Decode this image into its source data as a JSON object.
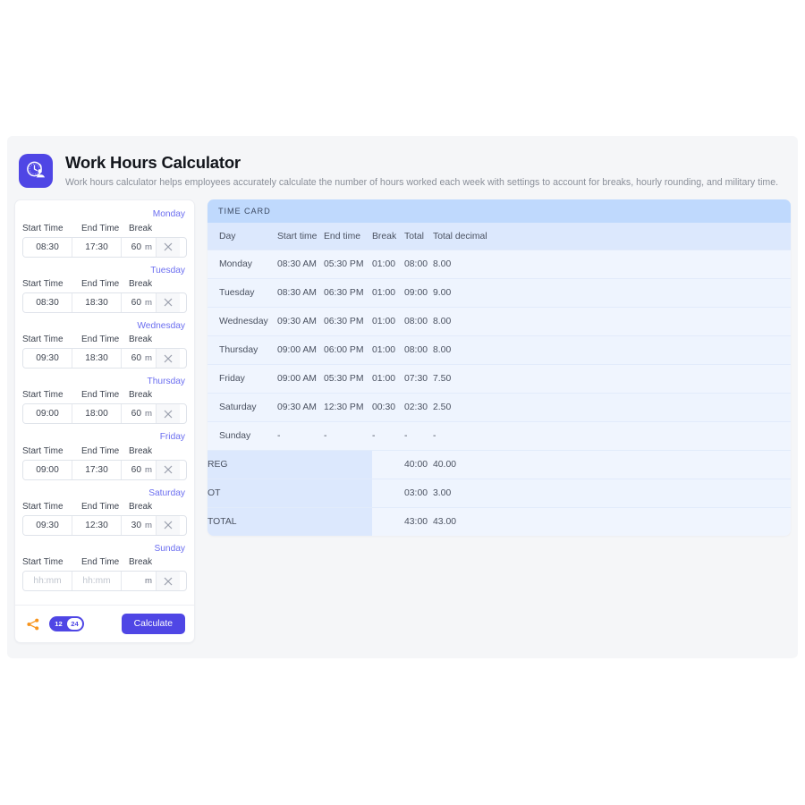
{
  "header": {
    "icon": "clock-hand-icon",
    "title": "Work Hours Calculator",
    "subtitle": "Work hours calculator helps employees accurately calculate the number of hours worked each week with settings to account for breaks, hourly rounding, and military time."
  },
  "form": {
    "column_headers": {
      "start": "Start Time",
      "end": "End Time",
      "break": "Break"
    },
    "break_unit": "m",
    "time_placeholder": "hh:mm",
    "break_placeholder": "",
    "clear_icon": "close-x-icon",
    "rows": [
      {
        "day": "Monday",
        "start": "08:30",
        "end": "17:30",
        "break": "60"
      },
      {
        "day": "Tuesday",
        "start": "08:30",
        "end": "18:30",
        "break": "60"
      },
      {
        "day": "Wednesday",
        "start": "09:30",
        "end": "18:30",
        "break": "60"
      },
      {
        "day": "Thursday",
        "start": "09:00",
        "end": "18:00",
        "break": "60"
      },
      {
        "day": "Friday",
        "start": "09:00",
        "end": "17:30",
        "break": "60"
      },
      {
        "day": "Saturday",
        "start": "09:30",
        "end": "12:30",
        "break": "30"
      },
      {
        "day": "Sunday",
        "start": "",
        "end": "",
        "break": ""
      }
    ],
    "footer": {
      "share_icon": "share-nodes-icon",
      "hour_format_12": "12",
      "hour_format_24": "24",
      "hour_format_selected": "24",
      "calculate_label": "Calculate"
    }
  },
  "time_card": {
    "title": "TIME CARD",
    "headers": [
      "Day",
      "Start time",
      "End time",
      "Break",
      "Total",
      "Total decimal"
    ],
    "rows": [
      {
        "day": "Monday",
        "start": "08:30 AM",
        "end": "05:30 PM",
        "break": "01:00",
        "total": "08:00",
        "decimal": "8.00"
      },
      {
        "day": "Tuesday",
        "start": "08:30 AM",
        "end": "06:30 PM",
        "break": "01:00",
        "total": "09:00",
        "decimal": "9.00"
      },
      {
        "day": "Wednesday",
        "start": "09:30 AM",
        "end": "06:30 PM",
        "break": "01:00",
        "total": "08:00",
        "decimal": "8.00"
      },
      {
        "day": "Thursday",
        "start": "09:00 AM",
        "end": "06:00 PM",
        "break": "01:00",
        "total": "08:00",
        "decimal": "8.00"
      },
      {
        "day": "Friday",
        "start": "09:00 AM",
        "end": "05:30 PM",
        "break": "01:00",
        "total": "07:30",
        "decimal": "7.50"
      },
      {
        "day": "Saturday",
        "start": "09:30 AM",
        "end": "12:30 PM",
        "break": "00:30",
        "total": "02:30",
        "decimal": "2.50"
      },
      {
        "day": "Sunday",
        "start": "-",
        "end": "-",
        "break": "-",
        "total": "-",
        "decimal": "-"
      }
    ],
    "summary": [
      {
        "label": "REG",
        "total": "40:00",
        "decimal": "40.00"
      },
      {
        "label": "OT",
        "total": "03:00",
        "decimal": "3.00"
      },
      {
        "label": "TOTAL",
        "total": "43:00",
        "decimal": "43.00"
      }
    ]
  },
  "colors": {
    "accent": "#4f46e5",
    "day_label": "#6b6ef0",
    "card_header": "#bfd9fd",
    "table_header": "#dce8fd",
    "row": "#f0f5fe",
    "share": "#f7941d"
  }
}
